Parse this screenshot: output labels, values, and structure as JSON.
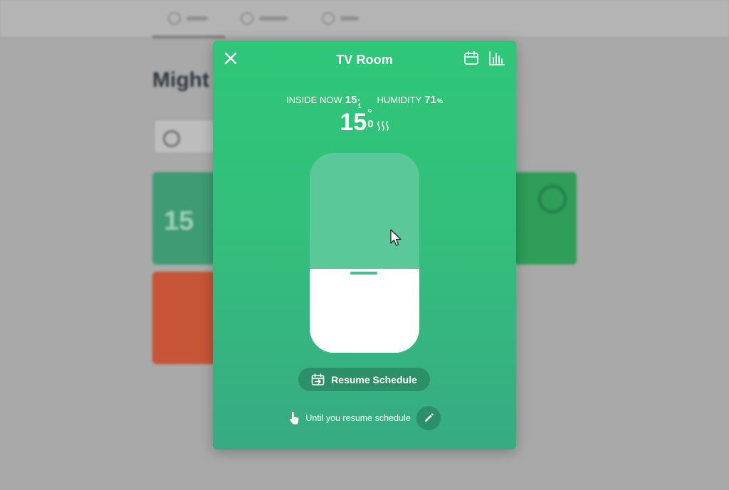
{
  "modal": {
    "title": "TV Room",
    "inside_label": "INSIDE NOW",
    "inside_value": "15",
    "inside_decimal": "1",
    "inside_unit": "°",
    "humidity_label": "HUMIDITY",
    "humidity_value": "71",
    "humidity_unit": "%",
    "setpoint_value": "15",
    "setpoint_decimal": "0",
    "setpoint_unit": "°",
    "slider_level_fraction": 0.42,
    "resume_label": "Resume Schedule",
    "until_text": "Until you resume schedule"
  },
  "icons": {
    "close": "close-icon",
    "calendar": "calendar-icon",
    "chart": "bar-chart-icon",
    "heat": "heat-waves-icon",
    "resume": "calendar-arrow-icon",
    "hand": "hand-pointer-icon",
    "edit": "pencil-icon",
    "cursor": "mouse-cursor-icon"
  },
  "colors": {
    "modal_top": "#2ec778",
    "modal_bottom": "#37ab83",
    "slider_track": "#5ac899",
    "slider_fill": "#ffffff",
    "button_bg": "#2b8f67"
  }
}
